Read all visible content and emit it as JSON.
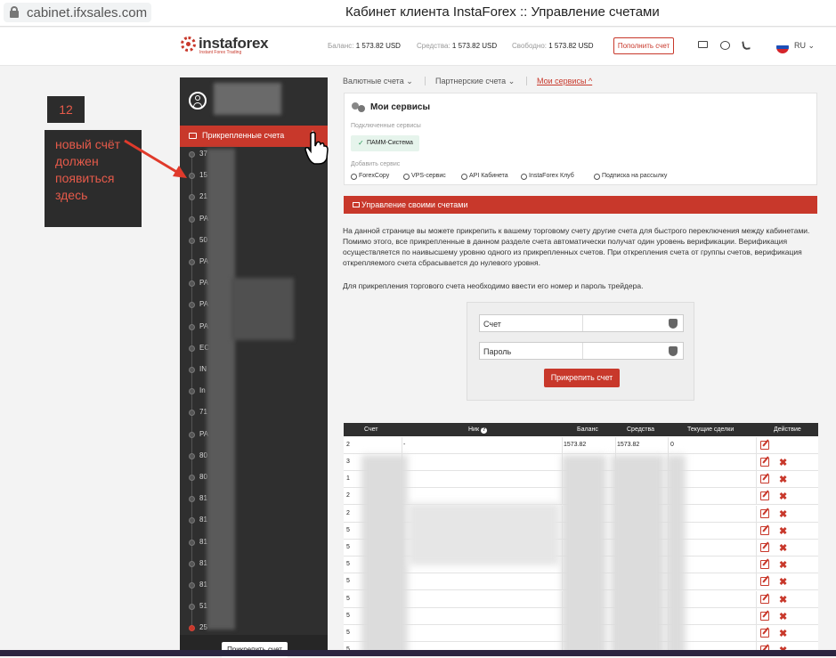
{
  "browser": {
    "url": "cabinet.ifxsales.com",
    "title": "Кабинет клиента InstaForex :: Управление счетами"
  },
  "header": {
    "brand": "instaforex",
    "tagline": "Instant Forex Trading",
    "balance_label": "Баланс:",
    "balance": "1 573.82 USD",
    "funds_label": "Средства:",
    "funds": "1 573.82 USD",
    "free_label": "Свободно:",
    "free": "1 573.82 USD",
    "topup": "Пополнить счет",
    "lang": "RU",
    "flag_colors": [
      "#ffffff",
      "#1c4fb8",
      "#d5242b"
    ]
  },
  "sidebar": {
    "section_label": "Прикрепленные счета",
    "chevron": "^",
    "accounts": [
      "37",
      "15",
      "21",
      "PA",
      "50",
      "PA",
      "PA",
      "PA",
      "PA",
      "EC",
      "IN",
      "In",
      "71",
      "PA",
      "80",
      "80",
      "81",
      "81",
      "81",
      "81",
      "81",
      "51",
      "25"
    ],
    "attach_button": "Прикрепить счет"
  },
  "annotation": {
    "badge": "12",
    "note": "новый счёт должен появиться здесь"
  },
  "tabs": [
    {
      "label": "Валютные счета",
      "chevron": "⌄"
    },
    {
      "label": "Партнерские счета",
      "chevron": "⌄"
    },
    {
      "label": "Мои сервисы",
      "chevron": "^"
    }
  ],
  "services": {
    "title": "Мои сервисы",
    "connected_label": "Подключенные сервисы",
    "connected": "ПАММ-Система",
    "add_label": "Добавить сервис",
    "add": [
      "ForexCopy",
      "VPS-сервис",
      "API Кабинета",
      "InstaForex Клуб",
      "Подписка на рассылку"
    ]
  },
  "management": {
    "title": "Управление своими счетами",
    "p1": "На данной странице вы можете прикрепить к вашему торговому счету другие счета для быстрого переключения между кабинетами. Помимо этого, все прикрепленные в данном разделе счета автоматически получат один уровень верификации. Верификация осуществляется по наивысшему уровню одного из прикрепленных счетов. При открепления счета от группы счетов, верификация открепляемого счета сбрасывается до нулевого уровня.",
    "p2": "Для прикрепления торгового счета необходимо ввести его номер и пароль трейдера."
  },
  "form": {
    "account_label": "Счет",
    "password_label": "Пароль",
    "submit": "Прикрепить счет"
  },
  "table": {
    "headers": [
      "Счет",
      "Ник",
      "Баланс",
      "Средства",
      "Текущие сделки",
      "Действие"
    ],
    "first_row": {
      "account": "2",
      "nick": "-",
      "balance": "1573.82",
      "funds": "1573.82",
      "deals": "0"
    },
    "row_prefixes": [
      "3",
      "1",
      "2",
      "2",
      "5",
      "5",
      "5",
      "5",
      "5",
      "5",
      "5",
      "5"
    ]
  }
}
